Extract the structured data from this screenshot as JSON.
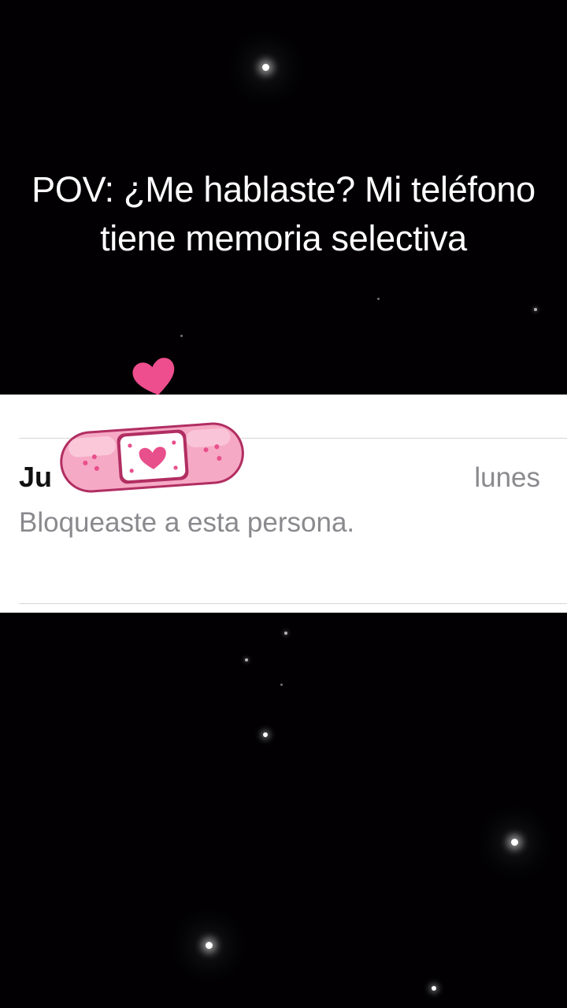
{
  "caption": {
    "text": "POV: ¿Me hablaste? Mi teléfono tiene memoria selectiva"
  },
  "chat_row": {
    "name_visible": "Ju",
    "date": "lunes",
    "preview": "Bloqueaste a esta persona."
  },
  "colors": {
    "background": "#020003",
    "card": "#ffffff",
    "secondary_text": "#8a8a8e",
    "sticker_pink": "#f2a3bf",
    "sticker_accent": "#e8508c"
  },
  "icons": {
    "heart": "heart-icon",
    "bandage": "bandage-sticker-icon"
  }
}
